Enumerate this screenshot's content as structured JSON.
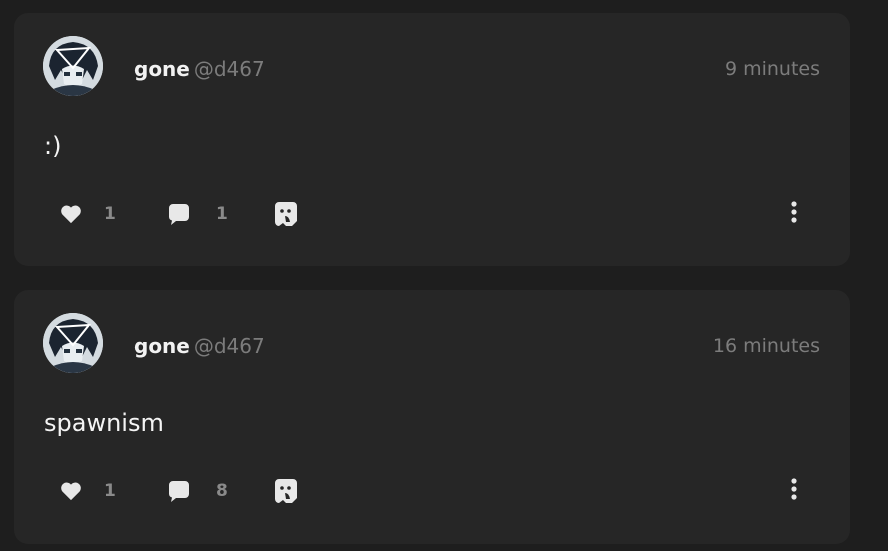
{
  "posts": [
    {
      "author": {
        "display_name": "gone",
        "handle": "@d467",
        "avatar_icon": "anime-avatar-icon"
      },
      "time_ago": "9 minutes",
      "text": ":)",
      "likes": "1",
      "replies": "1"
    },
    {
      "author": {
        "display_name": "gone",
        "handle": "@d467",
        "avatar_icon": "anime-avatar-icon"
      },
      "time_ago": "16 minutes",
      "text": "spawnism",
      "likes": "1",
      "replies": "8"
    }
  ],
  "icons": {
    "like": "heart-icon",
    "reply": "speech-bubble-icon",
    "share": "ghost-share-icon",
    "more": "vertical-ellipsis-icon"
  },
  "colors": {
    "page_background": "#1e1e1e",
    "card_background": "#262626",
    "primary_text": "#f2f2f2",
    "muted_text": "#7c7c7c",
    "icon": "#e8e8e8"
  }
}
